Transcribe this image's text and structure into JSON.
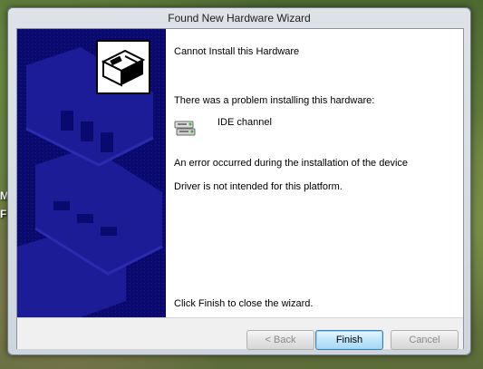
{
  "window": {
    "title": "Found New Hardware Wizard"
  },
  "desktop": {
    "partial_text": [
      "M",
      "Fi"
    ]
  },
  "content": {
    "heading": "Cannot Install this Hardware",
    "problem_text": "There was a problem installing this hardware:",
    "device_name": "IDE channel",
    "error_text": "An error occurred during the installation of the device",
    "reason_text": "Driver is not intended for this platform.",
    "finish_hint": "Click Finish to close the wizard."
  },
  "buttons": {
    "back": "< Back",
    "finish": "Finish",
    "cancel": "Cancel"
  },
  "colors": {
    "banner": "#0a0a6e",
    "default_button": "#bfe6fb"
  },
  "icons": [
    "hardware-wizard-icon",
    "ide-device-icon"
  ]
}
